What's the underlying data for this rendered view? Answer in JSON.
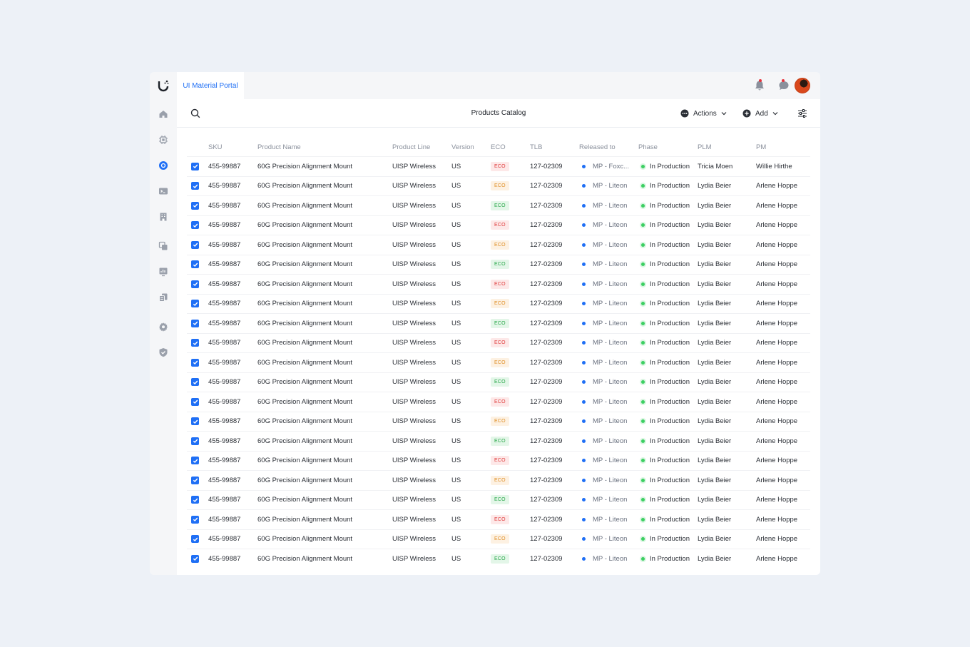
{
  "app": {
    "tab_label": "UI Material Portal",
    "page_title": "Products Catalog"
  },
  "toolbar": {
    "actions_label": "Actions",
    "add_label": "Add"
  },
  "sidebar": {
    "items": [
      "home-icon",
      "chip-icon",
      "circle-icon",
      "terminal-icon",
      "building-icon",
      "layers-icon",
      "chart-icon",
      "files-icon",
      "gear-icon",
      "shield-icon"
    ],
    "active_index": 2
  },
  "colors": {
    "accent": "#1f6ff5",
    "eco_red": "#e03e3e",
    "eco_orange": "#e0902a",
    "eco_green": "#2aa84a"
  },
  "table": {
    "headers": [
      "SKU",
      "Product Name",
      "Product Line",
      "Version",
      "ECO",
      "TLB",
      "Released to",
      "Phase",
      "PLM",
      "PM"
    ],
    "rows": [
      {
        "sku": "455-99887",
        "name": "60G Precision Alignment Mount",
        "line": "UISP Wireless",
        "version": "US",
        "eco": "ECO",
        "eco_color": "red",
        "tlb": "127-02309",
        "released": "MP - Foxc...",
        "phase": "In Production",
        "plm": "Tricia Moen",
        "pm": "Willie Hirthe"
      },
      {
        "sku": "455-99887",
        "name": "60G Precision Alignment Mount",
        "line": "UISP Wireless",
        "version": "US",
        "eco": "ECO",
        "eco_color": "orange",
        "tlb": "127-02309",
        "released": "MP - Liteon",
        "phase": "In Production",
        "plm": "Lydia Beier",
        "pm": "Arlene Hoppe"
      },
      {
        "sku": "455-99887",
        "name": "60G Precision Alignment Mount",
        "line": "UISP Wireless",
        "version": "US",
        "eco": "ECO",
        "eco_color": "green",
        "tlb": "127-02309",
        "released": "MP - Liteon",
        "phase": "In Production",
        "plm": "Lydia Beier",
        "pm": "Arlene Hoppe"
      },
      {
        "sku": "455-99887",
        "name": "60G Precision Alignment Mount",
        "line": "UISP Wireless",
        "version": "US",
        "eco": "ECO",
        "eco_color": "red",
        "tlb": "127-02309",
        "released": "MP - Liteon",
        "phase": "In Production",
        "plm": "Lydia Beier",
        "pm": "Arlene Hoppe"
      },
      {
        "sku": "455-99887",
        "name": "60G Precision Alignment Mount",
        "line": "UISP Wireless",
        "version": "US",
        "eco": "ECO",
        "eco_color": "orange",
        "tlb": "127-02309",
        "released": "MP - Liteon",
        "phase": "In Production",
        "plm": "Lydia Beier",
        "pm": "Arlene Hoppe"
      },
      {
        "sku": "455-99887",
        "name": "60G Precision Alignment Mount",
        "line": "UISP Wireless",
        "version": "US",
        "eco": "ECO",
        "eco_color": "green",
        "tlb": "127-02309",
        "released": "MP - Liteon",
        "phase": "In Production",
        "plm": "Lydia Beier",
        "pm": "Arlene Hoppe"
      },
      {
        "sku": "455-99887",
        "name": "60G Precision Alignment Mount",
        "line": "UISP Wireless",
        "version": "US",
        "eco": "ECO",
        "eco_color": "red",
        "tlb": "127-02309",
        "released": "MP - Liteon",
        "phase": "In Production",
        "plm": "Lydia Beier",
        "pm": "Arlene Hoppe"
      },
      {
        "sku": "455-99887",
        "name": "60G Precision Alignment Mount",
        "line": "UISP Wireless",
        "version": "US",
        "eco": "ECO",
        "eco_color": "orange",
        "tlb": "127-02309",
        "released": "MP - Liteon",
        "phase": "In Production",
        "plm": "Lydia Beier",
        "pm": "Arlene Hoppe"
      },
      {
        "sku": "455-99887",
        "name": "60G Precision Alignment Mount",
        "line": "UISP Wireless",
        "version": "US",
        "eco": "ECO",
        "eco_color": "green",
        "tlb": "127-02309",
        "released": "MP - Liteon",
        "phase": "In Production",
        "plm": "Lydia Beier",
        "pm": "Arlene Hoppe"
      },
      {
        "sku": "455-99887",
        "name": "60G Precision Alignment Mount",
        "line": "UISP Wireless",
        "version": "US",
        "eco": "ECO",
        "eco_color": "red",
        "tlb": "127-02309",
        "released": "MP - Liteon",
        "phase": "In Production",
        "plm": "Lydia Beier",
        "pm": "Arlene Hoppe"
      },
      {
        "sku": "455-99887",
        "name": "60G Precision Alignment Mount",
        "line": "UISP Wireless",
        "version": "US",
        "eco": "ECO",
        "eco_color": "orange",
        "tlb": "127-02309",
        "released": "MP - Liteon",
        "phase": "In Production",
        "plm": "Lydia Beier",
        "pm": "Arlene Hoppe"
      },
      {
        "sku": "455-99887",
        "name": "60G Precision Alignment Mount",
        "line": "UISP Wireless",
        "version": "US",
        "eco": "ECO",
        "eco_color": "green",
        "tlb": "127-02309",
        "released": "MP - Liteon",
        "phase": "In Production",
        "plm": "Lydia Beier",
        "pm": "Arlene Hoppe"
      },
      {
        "sku": "455-99887",
        "name": "60G Precision Alignment Mount",
        "line": "UISP Wireless",
        "version": "US",
        "eco": "ECO",
        "eco_color": "red",
        "tlb": "127-02309",
        "released": "MP - Liteon",
        "phase": "In Production",
        "plm": "Lydia Beier",
        "pm": "Arlene Hoppe"
      },
      {
        "sku": "455-99887",
        "name": "60G Precision Alignment Mount",
        "line": "UISP Wireless",
        "version": "US",
        "eco": "ECO",
        "eco_color": "orange",
        "tlb": "127-02309",
        "released": "MP - Liteon",
        "phase": "In Production",
        "plm": "Lydia Beier",
        "pm": "Arlene Hoppe"
      },
      {
        "sku": "455-99887",
        "name": "60G Precision Alignment Mount",
        "line": "UISP Wireless",
        "version": "US",
        "eco": "ECO",
        "eco_color": "green",
        "tlb": "127-02309",
        "released": "MP - Liteon",
        "phase": "In Production",
        "plm": "Lydia Beier",
        "pm": "Arlene Hoppe"
      },
      {
        "sku": "455-99887",
        "name": "60G Precision Alignment Mount",
        "line": "UISP Wireless",
        "version": "US",
        "eco": "ECO",
        "eco_color": "red",
        "tlb": "127-02309",
        "released": "MP - Liteon",
        "phase": "In Production",
        "plm": "Lydia Beier",
        "pm": "Arlene Hoppe"
      },
      {
        "sku": "455-99887",
        "name": "60G Precision Alignment Mount",
        "line": "UISP Wireless",
        "version": "US",
        "eco": "ECO",
        "eco_color": "orange",
        "tlb": "127-02309",
        "released": "MP - Liteon",
        "phase": "In Production",
        "plm": "Lydia Beier",
        "pm": "Arlene Hoppe"
      },
      {
        "sku": "455-99887",
        "name": "60G Precision Alignment Mount",
        "line": "UISP Wireless",
        "version": "US",
        "eco": "ECO",
        "eco_color": "green",
        "tlb": "127-02309",
        "released": "MP - Liteon",
        "phase": "In Production",
        "plm": "Lydia Beier",
        "pm": "Arlene Hoppe"
      },
      {
        "sku": "455-99887",
        "name": "60G Precision Alignment Mount",
        "line": "UISP Wireless",
        "version": "US",
        "eco": "ECO",
        "eco_color": "red",
        "tlb": "127-02309",
        "released": "MP - Liteon",
        "phase": "In Production",
        "plm": "Lydia Beier",
        "pm": "Arlene Hoppe"
      },
      {
        "sku": "455-99887",
        "name": "60G Precision Alignment Mount",
        "line": "UISP Wireless",
        "version": "US",
        "eco": "ECO",
        "eco_color": "orange",
        "tlb": "127-02309",
        "released": "MP - Liteon",
        "phase": "In Production",
        "plm": "Lydia Beier",
        "pm": "Arlene Hoppe"
      },
      {
        "sku": "455-99887",
        "name": "60G Precision Alignment Mount",
        "line": "UISP Wireless",
        "version": "US",
        "eco": "ECO",
        "eco_color": "green",
        "tlb": "127-02309",
        "released": "MP - Liteon",
        "phase": "In Production",
        "plm": "Lydia Beier",
        "pm": "Arlene Hoppe"
      }
    ]
  }
}
